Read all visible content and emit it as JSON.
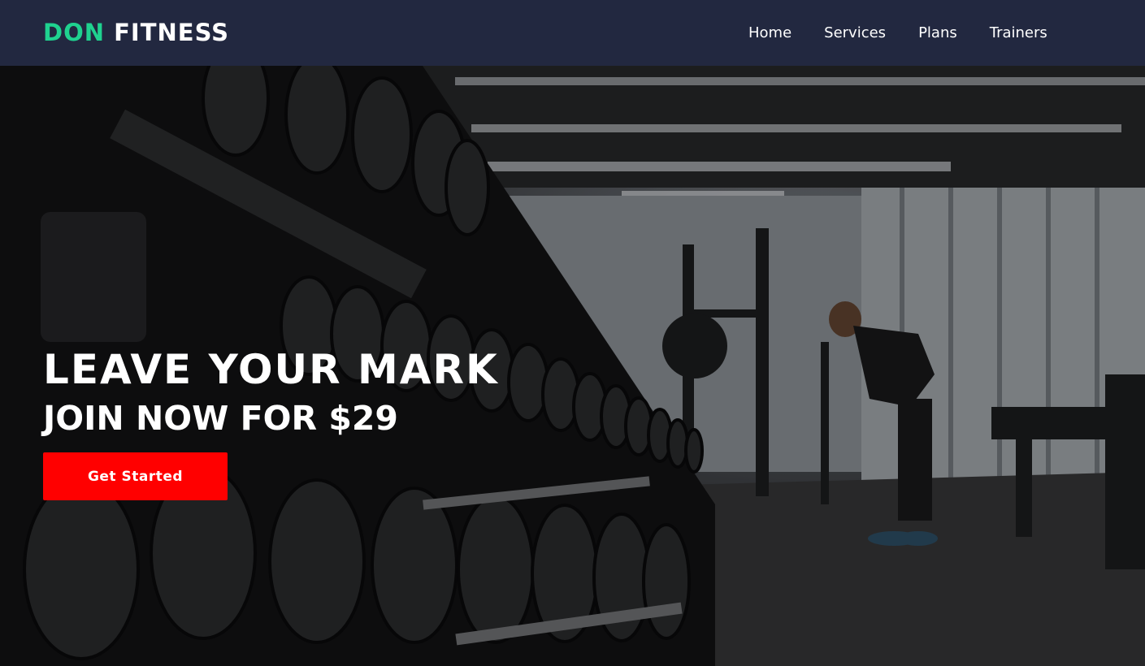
{
  "brand": {
    "name_accent": "DON",
    "name_main": "FITNESS",
    "accent_color": "#1fd28f"
  },
  "nav": {
    "items": [
      {
        "label": "Home"
      },
      {
        "label": "Services"
      },
      {
        "label": "Plans"
      },
      {
        "label": "Trainers"
      }
    ],
    "background_color": "#222840"
  },
  "hero": {
    "title": "LEAVE YOUR MARK",
    "subtitle": "JOIN NOW FOR $29",
    "cta_label": "Get Started",
    "cta_color": "#ff0000",
    "background_image": "gym-dumbbell-rack-photo"
  }
}
